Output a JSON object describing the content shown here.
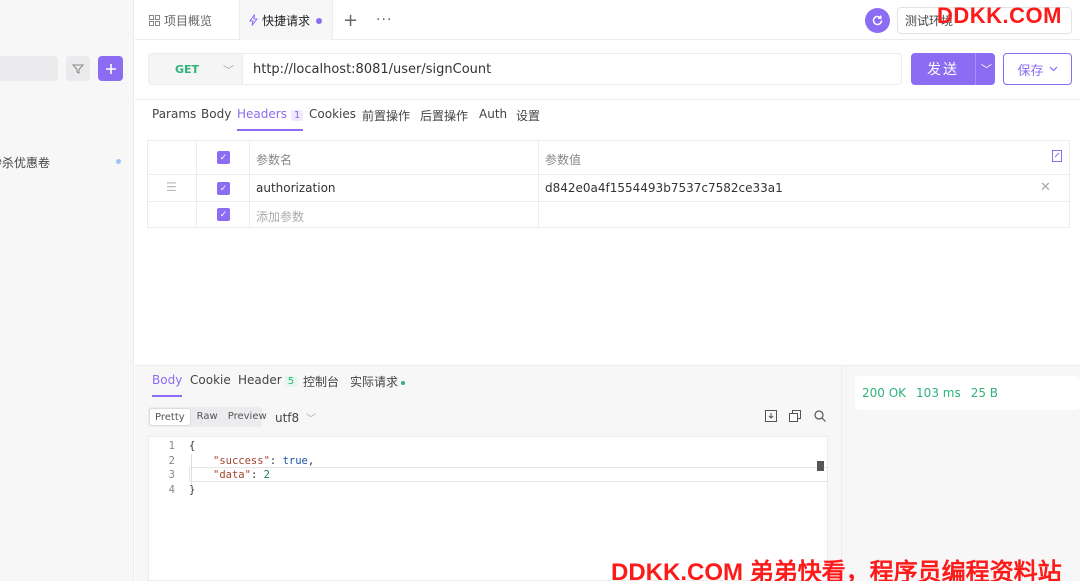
{
  "sidebar": {
    "filter_icon": "filter-icon",
    "add_icon": "plus-icon",
    "item_label": "秒杀优惠卷"
  },
  "topbar": {
    "overview_tab": "项目概览",
    "quick_tab": "快捷请求",
    "add_tab": "+",
    "more": "···",
    "env_label": "测试环境"
  },
  "request": {
    "method": "GET",
    "url": "http://localhost:8081/user/signCount",
    "send_label": "发送",
    "save_label": "保存"
  },
  "request_tabs": [
    {
      "label": "Params"
    },
    {
      "label": "Body"
    },
    {
      "label": "Headers",
      "badge": "1"
    },
    {
      "label": "Cookies"
    },
    {
      "label": "前置操作"
    },
    {
      "label": "后置操作"
    },
    {
      "label": "Auth"
    },
    {
      "label": "设置"
    }
  ],
  "headers_table": {
    "col_name": "参数名",
    "col_value": "参数值",
    "rows": [
      {
        "name": "authorization",
        "value": "d842e0a4f1554493b7537c7582ce33a1"
      }
    ],
    "add_placeholder": "添加参数"
  },
  "response": {
    "tabs": [
      {
        "label": "Body"
      },
      {
        "label": "Cookie"
      },
      {
        "label": "Header",
        "badge": "5"
      },
      {
        "label": "控制台"
      },
      {
        "label": "实际请求"
      }
    ],
    "formats": [
      "Pretty",
      "Raw",
      "Preview"
    ],
    "encoding": "utf8",
    "status": "200 OK",
    "time": "103 ms",
    "size": "25 B",
    "code_lines": [
      "1",
      "2",
      "3",
      "4"
    ],
    "json": {
      "open": "{",
      "k1": "\"success\"",
      "v1": "true",
      "k2": "\"data\"",
      "v2": "2",
      "close": "}"
    }
  },
  "watermark": {
    "top": "DDKK.COM",
    "bottom": "DDKK.COM 弟弟快看，程序员编程资料站"
  }
}
